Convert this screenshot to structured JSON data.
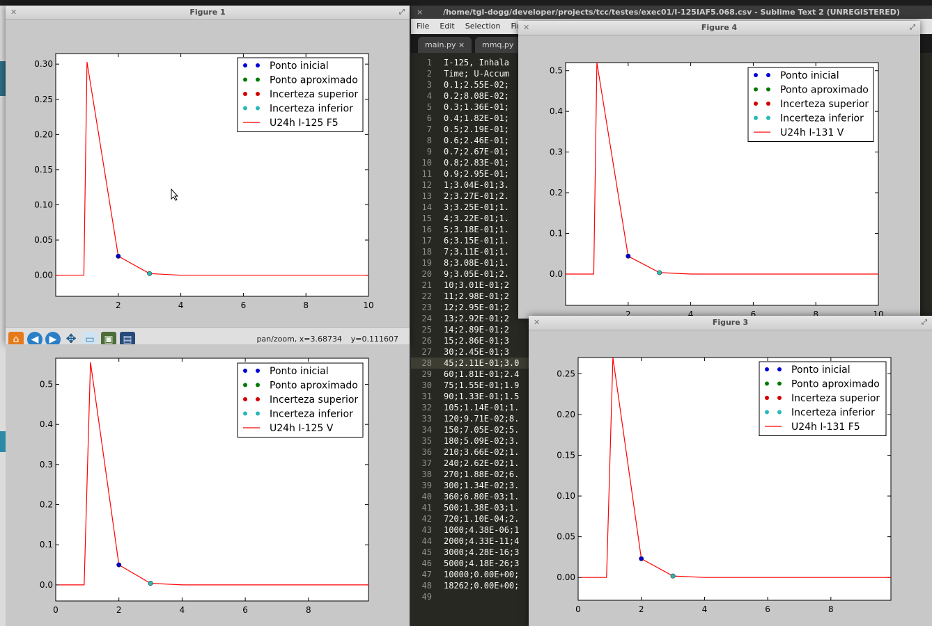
{
  "colors": {
    "blue": "#0000d4",
    "green": "#007a00",
    "red": "#d40000",
    "cyan": "#2ab8b8",
    "line": "#ff0000"
  },
  "legend_common": [
    "Ponto inicial",
    "Ponto aproximado",
    "Incerteza superior",
    "Incerteza inferior"
  ],
  "editor": {
    "title": "/home/tgl-dogg/developer/projects/tcc/testes/exec01/I-125IAF5.068.csv - Sublime Text 2 (UNREGISTERED)",
    "menu": [
      "File",
      "Edit",
      "Selection",
      "Find"
    ],
    "tabs": [
      "main.py",
      "mmq.py"
    ],
    "tab_close": "×",
    "lines": [
      "I-125, Inhala",
      "Time; U-Accum",
      "0.1;2.55E-02;",
      "0.2;8.08E-02;",
      "0.3;1.36E-01;",
      "0.4;1.82E-01;",
      "0.5;2.19E-01;",
      "0.6;2.46E-01;",
      "0.7;2.67E-01;",
      "0.8;2.83E-01;",
      "0.9;2.95E-01;",
      "1;3.04E-01;3.",
      "2;3.27E-01;2.",
      "3;3.25E-01;1.",
      "4;3.22E-01;1.",
      "5;3.18E-01;1.",
      "6;3.15E-01;1.",
      "7;3.11E-01;1.",
      "8;3.08E-01;1.",
      "9;3.05E-01;2.",
      "10;3.01E-01;2",
      "11;2.98E-01;2",
      "12;2.95E-01;2",
      "13;2.92E-01;2",
      "14;2.89E-01;2",
      "15;2.86E-01;3",
      "30;2.45E-01;3",
      "45;2.11E-01;3.0",
      "60;1.81E-01;2.4",
      "75;1.55E-01;1.9",
      "90;1.33E-01;1.5",
      "105;1.14E-01;1.",
      "120;9.71E-02;8.",
      "150;7.05E-02;5.",
      "180;5.09E-02;3.",
      "210;3.66E-02;1.",
      "240;2.62E-02;1.",
      "270;1.88E-02;6.",
      "300;1.34E-02;3.",
      "360;6.80E-03;1.",
      "500;1.38E-03;1.",
      "720;1.10E-04;2.",
      "1000;4.38E-06;1",
      "2000;4.33E-11;4",
      "3000;4.28E-16;3",
      "5000;4.18E-26;3",
      "10000;0.00E+00;",
      "18262;0.00E+00;",
      ""
    ],
    "current_line": 28
  },
  "fig1": {
    "title": "Figure 1",
    "status": "pan/zoom, x=3.68734",
    "status_y": "y=0.111607",
    "toolbar": [
      "home",
      "back",
      "forward",
      "pan",
      "zoom",
      "configure",
      "save"
    ]
  },
  "fig4": {
    "title": "Figure 4"
  },
  "fig3": {
    "title": "Figure 3"
  },
  "chart_data": [
    {
      "id": "fig1",
      "type": "line",
      "series_label": "U24h I-125 F5",
      "peak": 0.303,
      "xlim": [
        0,
        10
      ],
      "ylim": [
        -0.03,
        0.315
      ],
      "yticks": [
        0.0,
        0.05,
        0.1,
        0.15,
        0.2,
        0.25,
        0.3
      ],
      "ytick_labels": [
        "0.00",
        "0.05",
        "0.10",
        "0.15",
        "0.20",
        "0.25",
        "0.30"
      ],
      "xticks": [
        2,
        4,
        6,
        8,
        10
      ],
      "line_x": [
        0,
        0.9,
        1,
        2,
        3,
        4,
        10
      ],
      "line_y": [
        0,
        0,
        0.303,
        0.027,
        0.0023,
        0,
        0
      ],
      "points": [
        {
          "x": 2,
          "y": 0.027,
          "color": "blue"
        },
        {
          "x": 3,
          "y": 0.0023,
          "color": "cyan"
        }
      ]
    },
    {
      "id": "fig2",
      "type": "line",
      "series_label": "U24h I-125 V",
      "peak": 0.555,
      "xlim": [
        0,
        9.9
      ],
      "ylim": [
        -0.04,
        0.565
      ],
      "yticks": [
        0.0,
        0.1,
        0.2,
        0.3,
        0.4,
        0.5
      ],
      "ytick_labels": [
        "0.0",
        "0.1",
        "0.2",
        "0.3",
        "0.4",
        "0.5"
      ],
      "xticks": [
        0,
        2,
        4,
        6,
        8
      ],
      "line_x": [
        0.1,
        0.9,
        1.1,
        2,
        3,
        4,
        9.9
      ],
      "line_y": [
        0,
        0,
        0.555,
        0.05,
        0.004,
        0,
        0
      ],
      "points": [
        {
          "x": 2,
          "y": 0.05,
          "color": "blue"
        },
        {
          "x": 3,
          "y": 0.004,
          "color": "cyan"
        }
      ]
    },
    {
      "id": "fig4",
      "type": "line",
      "series_label": "U24h I-131 V",
      "peak": 0.52,
      "xlim": [
        0,
        10
      ],
      "ylim": [
        -0.077,
        0.52
      ],
      "yticks": [
        0.0,
        0.1,
        0.2,
        0.3,
        0.4,
        0.5
      ],
      "ytick_labels": [
        "0.0",
        "0.1",
        "0.2",
        "0.3",
        "0.4",
        "0.5"
      ],
      "xticks": [
        2,
        4,
        6,
        8,
        10
      ],
      "line_x": [
        0,
        0.9,
        1,
        2,
        3,
        4,
        10
      ],
      "line_y": [
        0,
        0,
        0.52,
        0.044,
        0.0035,
        0,
        0
      ],
      "points": [
        {
          "x": 2,
          "y": 0.044,
          "color": "blue"
        },
        {
          "x": 3,
          "y": 0.0035,
          "color": "cyan"
        }
      ]
    },
    {
      "id": "fig3",
      "type": "line",
      "series_label": "U24h I-131 F5",
      "peak": 0.27,
      "xlim": [
        0,
        9.9
      ],
      "ylim": [
        -0.028,
        0.27
      ],
      "yticks": [
        0.0,
        0.05,
        0.1,
        0.15,
        0.2,
        0.25
      ],
      "ytick_labels": [
        "0.00",
        "0.05",
        "0.10",
        "0.15",
        "0.20",
        "0.25"
      ],
      "xticks": [
        0,
        2,
        4,
        6,
        8
      ],
      "line_x": [
        0.1,
        0.9,
        1.1,
        2,
        3,
        4,
        9.9
      ],
      "line_y": [
        0,
        0,
        0.27,
        0.023,
        0.0018,
        0,
        0
      ],
      "points": [
        {
          "x": 2,
          "y": 0.023,
          "color": "blue"
        },
        {
          "x": 3,
          "y": 0.0018,
          "color": "cyan"
        }
      ]
    }
  ]
}
